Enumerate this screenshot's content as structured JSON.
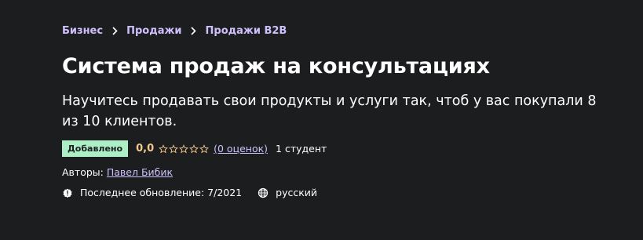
{
  "breadcrumb": {
    "items": [
      "Бизнес",
      "Продажи",
      "Продажи B2B"
    ]
  },
  "course": {
    "title": "Система продаж на консультациях",
    "subtitle": "Научитесь продавать свои продукты и услуги так, чтоб у вас покупали 8 из 10 клиентов."
  },
  "meta": {
    "badge": "Добавлено",
    "rating": "0,0",
    "stars_filled": 0,
    "stars_total": 5,
    "reviews": "(0 оценок)",
    "students": "1 студент"
  },
  "authors": {
    "label": "Авторы:",
    "name": "Павел Бибик"
  },
  "info": {
    "updated": "Последнее обновление: 7/2021",
    "language": "русский",
    "updated_icon": "alert-badge-icon",
    "language_icon": "globe-icon"
  },
  "colors": {
    "background": "#1c1d1f",
    "link": "#cec0fc",
    "badge": "#aceec5",
    "rating": "#f3ca8c"
  }
}
